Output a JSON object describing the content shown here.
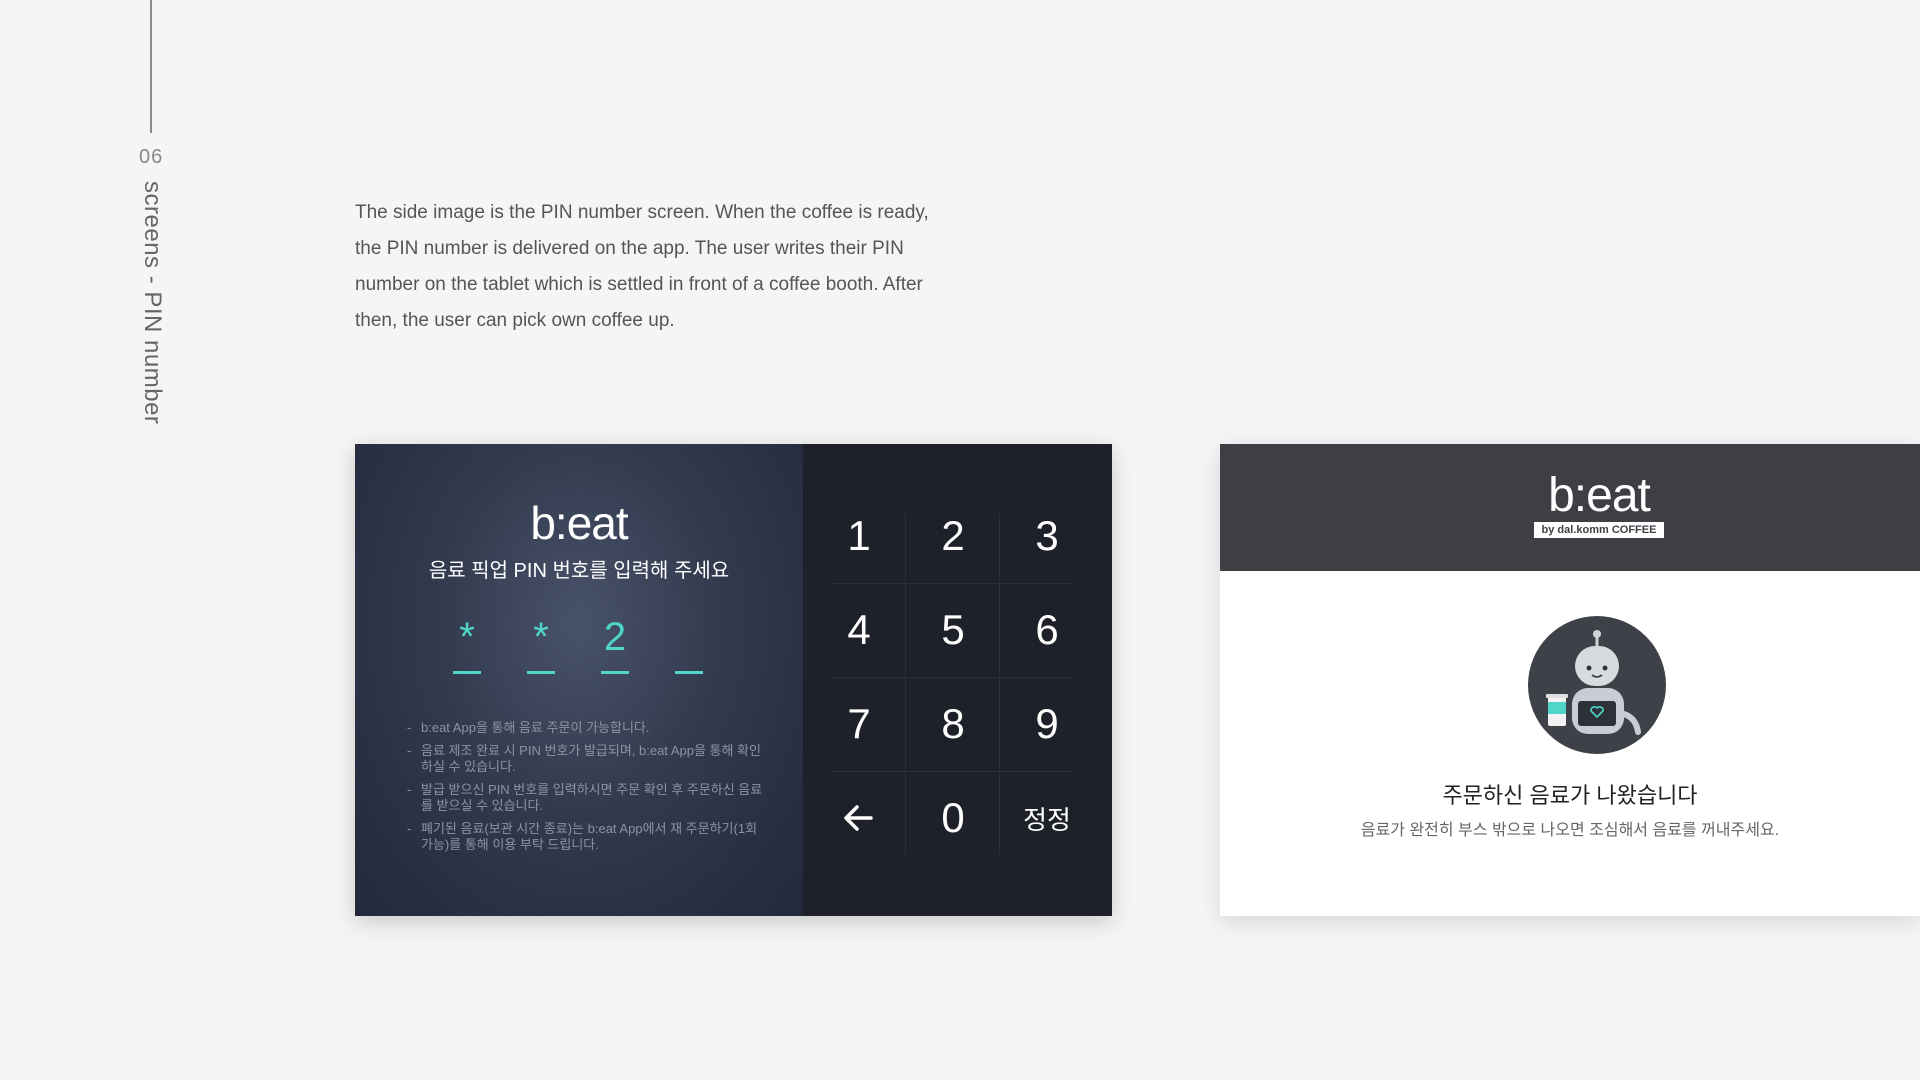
{
  "side": {
    "number": "06",
    "title": "screens - PIN number"
  },
  "description": "The side image is the PIN number screen. When the coffee is ready, the PIN number is delivered on the app. The user writes their PIN number on the tablet which is settled in front of a coffee booth. After then, the user can pick own coffee up.",
  "pin_screen": {
    "logo": "b:eat",
    "instruction": "음료 픽업 PIN 번호를 입력해 주세요",
    "digits": [
      "*",
      "*",
      "2",
      ""
    ],
    "notes": [
      "b:eat App을 통해 음료 주문이 가능합니다.",
      "음료 제조 완료 시 PIN 번호가 발급되며, b:eat App을 통해 확인하실 수 있습니다.",
      "발급 받으신 PIN 번호를 입력하시면 주문 확인 후 주문하신 음료를 받으실 수 있습니다.",
      "폐기된 음료(보관 시간 종료)는 b:eat App에서 재 주문하기(1회 가능)를 통해 이용 부탁 드립니다."
    ],
    "keypad": {
      "k1": "1",
      "k2": "2",
      "k3": "3",
      "k4": "4",
      "k5": "5",
      "k6": "6",
      "k7": "7",
      "k8": "8",
      "k9": "9",
      "back_icon": "left-arrow-icon",
      "k0": "0",
      "correct": "정정"
    },
    "colors": {
      "accent": "#4fd6c9",
      "panel_dark": "#1e2129",
      "panel_left": "#323a4d"
    }
  },
  "ready_screen": {
    "logo": "b:eat",
    "logo_sub": "by dal.komm COFFEE",
    "title": "주문하신 음료가 나왔습니다",
    "subtitle": "음료가 완전히 부스 밖으로 나오면 조심해서 음료를 꺼내주세요.",
    "robot_icon": "robot-holding-coffee-icon",
    "colors": {
      "header": "#3d3f45",
      "accent": "#4fd6c9"
    }
  }
}
